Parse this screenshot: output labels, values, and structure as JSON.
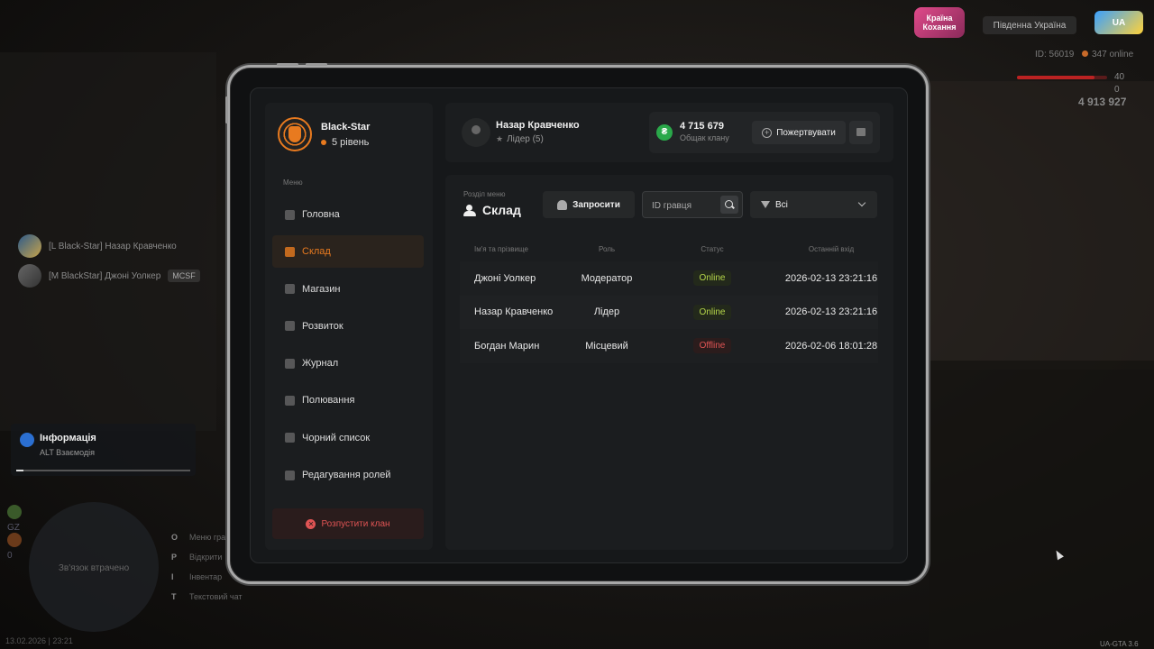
{
  "hud": {
    "logo_text": "Країна Кохання",
    "server": "Південна Україна",
    "brand": "UA",
    "player_id": "ID: 56019",
    "online": "347 online",
    "hp": "40",
    "armor": "0",
    "money": "4 913 927"
  },
  "voice_list": [
    {
      "name": "[L Black-Star] Назар Кравченко"
    },
    {
      "name": "[M BlackStar] Джоні Уолкер",
      "badge": "MCSF"
    }
  ],
  "info": {
    "title": "Інформація",
    "subtitle": "ALT Взаємодія",
    "progress": 0.04
  },
  "minimap": {
    "status": "Зв'язок втрачено",
    "stats": [
      "GZ",
      "0"
    ]
  },
  "hints": [
    {
      "key": "O",
      "label": "Меню гра"
    },
    {
      "key": "P",
      "label": "Відкрити"
    },
    {
      "key": "I",
      "label": "Інвентар"
    },
    {
      "key": "T",
      "label": "Текстовий чат"
    }
  ],
  "datetime": "13.02.2026 | 23:21",
  "version": "UA-GTA 3.6",
  "clan": {
    "name": "Black-Star",
    "level": "5 рівень"
  },
  "menu": {
    "caption": "Меню",
    "items": [
      {
        "label": "Головна",
        "active": false
      },
      {
        "label": "Склад",
        "active": true
      },
      {
        "label": "Магазин",
        "active": false
      },
      {
        "label": "Розвиток",
        "active": false
      },
      {
        "label": "Журнал",
        "active": false
      },
      {
        "label": "Полювання",
        "active": false
      },
      {
        "label": "Чорний список",
        "active": false
      },
      {
        "label": "Редагування ролей",
        "active": false
      }
    ],
    "disband_label": "Розпустити клан"
  },
  "user": {
    "name": "Назар Кравченко",
    "role": "Лідер (5)"
  },
  "bank": {
    "amount": "4 715 679",
    "label": "Общак клану",
    "donate_label": "Пожертвувати"
  },
  "section": {
    "caption": "Розділ меню",
    "title": "Склад",
    "invite_label": "Запросити",
    "search_placeholder": "ID гравця",
    "filter_value": "Всі"
  },
  "table": {
    "headers": {
      "name": "Ім'я та прізвище",
      "role": "Роль",
      "status": "Статус",
      "last": "Останній вхід"
    },
    "rows": [
      {
        "name": "Джоні Уолкер",
        "role": "Модератор",
        "status": "Online",
        "last": "2026-02-13 23:21:16"
      },
      {
        "name": "Назар Кравченко",
        "role": "Лідер",
        "status": "Online",
        "last": "2026-02-13 23:21:16"
      },
      {
        "name": "Богдан Марин",
        "role": "Місцевий",
        "status": "Offline",
        "last": "2026-02-06 18:01:28"
      }
    ]
  },
  "colors": {
    "accent": "#e87a1f",
    "online": "#b6d74a",
    "offline": "#e05454",
    "coin": "#2aa84a"
  }
}
